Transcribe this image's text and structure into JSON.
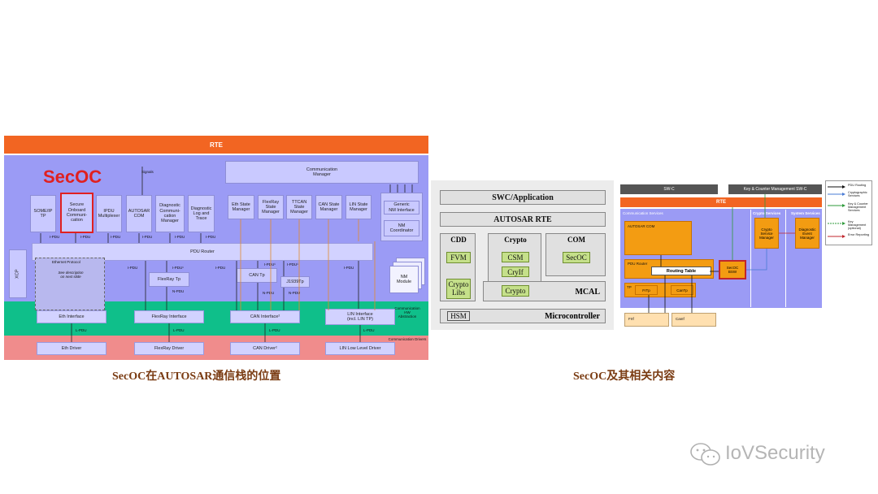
{
  "left_diagram": {
    "rte": "RTE",
    "secoc_label": "SecOC",
    "signals": "Signals",
    "comm_manager": "Communication\nManager",
    "modules": {
      "someip_tp": "SOME/IP\nTP",
      "secoc_module": "Secure\nOnboard\nCommuni-\ncation",
      "ipdu_mux": "IPDU\nMultiplexer",
      "autosar_com": "AUTOSAR\nCOM",
      "dcm": "Diagnostic\nCommuni-\ncation\nManager",
      "dlt": "Diagnostic\nLog and\nTrace",
      "eth_sm": "Eth State\nManager",
      "fr_sm": "FlexRay\nState\nManager",
      "ttcan_sm": "TTCAN\nState\nManager",
      "can_sm": "CAN State\nManager",
      "lin_sm": "LIN State\nManager",
      "generic_nm": "Generic\nNM Interface",
      "nm_coord": "NM\nCoordinator",
      "nm_module": "NM\nModule"
    },
    "xcp": "XCP",
    "pdu_router": "PDU Router",
    "eth_protocol": "Ethernet Protocol",
    "eth_protocol_note": "See description\non next slide",
    "flexray_tp": "FlexRay Tp",
    "can_tp": "CAN Tp",
    "j1939_tp": "J1939Tp",
    "ifaces": {
      "eth": "Eth Interface",
      "fr": "FlexRay Interface",
      "can": "CAN Interface²",
      "lin": "LIN Interface\n(incl. LIN TP)"
    },
    "drivers": {
      "eth": "Eth Driver",
      "fr": "FlexRay Driver",
      "can": "CAN Driver²",
      "lin": "LIN Low Level Driver"
    },
    "hw_abstraction": "Communication\nHW\nAbstraction",
    "comm_drivers": "Communication Drivers",
    "ipdu": "I-PDU",
    "ipdu1": "I-PDU¹",
    "npdu": "N-PDU",
    "lpdu": "L-PDU"
  },
  "middle_diagram": {
    "swc": "SWC/Application",
    "rte": "AUTOSAR RTE",
    "cdd": "CDD",
    "fvm": "FVM",
    "crypto_libs": "Crypto\nLibs",
    "crypto": "Crypto",
    "csm": "CSM",
    "cryif": "CryIf",
    "crypto_drv": "Crypto",
    "com": "COM",
    "secoc": "SecOC",
    "mcal": "MCAL",
    "hsm": "HSM",
    "micro": "Microcontroller"
  },
  "right_diagram": {
    "swc": "SW-C",
    "key_swc": "Key & Counter Management SW-C",
    "rte": "RTE",
    "comm_services": "Communication Services",
    "crypto_services": "Crypto Services",
    "system_services": "System Services",
    "autosar_com": "AUTOSAR COM",
    "pdu_router": "PDU Router",
    "routing_table": "Routing Table",
    "secoc_bsw": "SecOC\nBSW",
    "csm": "Crypto\nService\nManager",
    "dem": "Diagnostic\nEvent\nManager",
    "tp": "TP",
    "frtp": "FrTp",
    "cantp": "CanTp",
    "frif": "FrIf",
    "canif": "CanIf",
    "legend": [
      "PDU Routing",
      "Cryptographic\nServices",
      "Key & Counter\nManagement\nServices",
      "Key Management\n(optional)",
      "Error Reporting"
    ]
  },
  "captions": {
    "left": "SecOC在AUTOSAR通信栈的位置",
    "right": "SecOC及其相关内容"
  },
  "watermark": "IoVSecurity",
  "colors": {
    "rte": "#f26522",
    "stack_bg": "#9b9bf5",
    "hw_abs": "#0fbf8a",
    "drivers": "#f08c8c",
    "secoc_red": "#e02020",
    "orange_module": "#f39c12"
  }
}
